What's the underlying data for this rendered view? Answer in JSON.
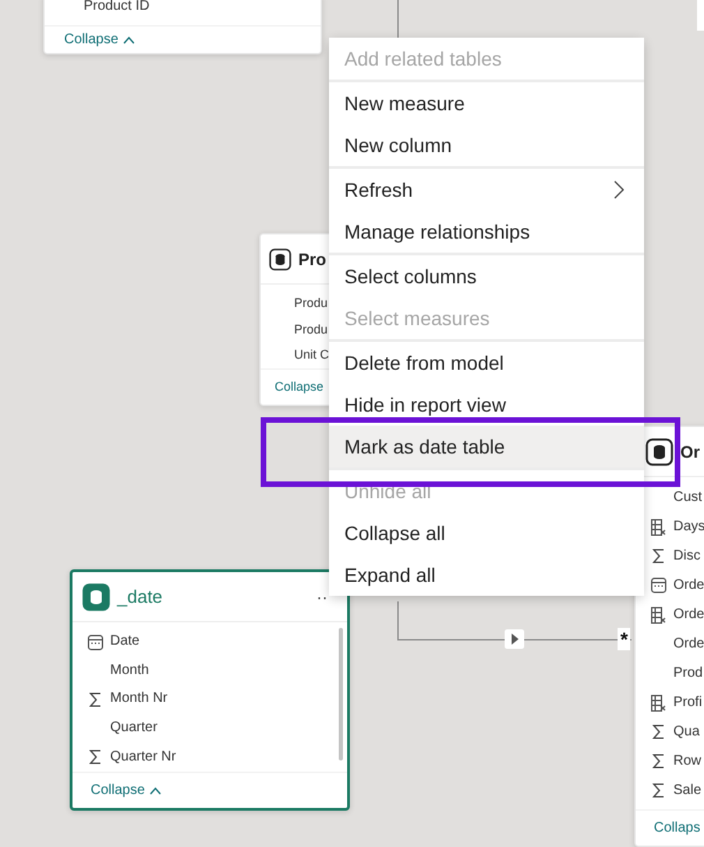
{
  "cards": [
    {
      "fields": [
        {
          "name": "Product ID",
          "kind": "plain"
        }
      ],
      "collapse": "Collapse",
      "selected": false
    },
    {
      "title": "Pro",
      "fields": [
        {
          "name": "Produ",
          "kind": "plain"
        },
        {
          "name": "Produ",
          "kind": "plain"
        },
        {
          "name": "Unit C",
          "kind": "plain"
        }
      ],
      "collapse": "Collapse",
      "selected": false
    },
    {
      "title": "Or",
      "fields": [
        {
          "name": "Cust",
          "kind": "plain"
        },
        {
          "name": "Days",
          "kind": "calculated"
        },
        {
          "name": "Disc",
          "kind": "sum"
        },
        {
          "name": "Orde",
          "kind": "date"
        },
        {
          "name": "Orde",
          "kind": "calculated"
        },
        {
          "name": "Orde",
          "kind": "plain"
        },
        {
          "name": "Prod",
          "kind": "plain"
        },
        {
          "name": "Profi",
          "kind": "calculated"
        },
        {
          "name": "Qua",
          "kind": "sum"
        },
        {
          "name": "Row",
          "kind": "sum"
        },
        {
          "name": "Sale",
          "kind": "sum"
        }
      ],
      "collapse": "Collaps",
      "selected": false
    },
    {
      "title": "_date",
      "fields": [
        {
          "name": "Date",
          "kind": "date"
        },
        {
          "name": "Month",
          "kind": "plain"
        },
        {
          "name": "Month Nr",
          "kind": "sum"
        },
        {
          "name": "Quarter",
          "kind": "plain"
        },
        {
          "name": "Quarter Nr",
          "kind": "sum"
        }
      ],
      "collapse": "Collapse",
      "selected": true,
      "more": "··"
    }
  ],
  "relationship": {
    "many_mark": "*"
  },
  "context_menu": {
    "items": [
      {
        "label": "Add related tables",
        "disabled": true,
        "submenu": false,
        "selected": false,
        "divider_after": true
      },
      {
        "label": "New measure",
        "disabled": false,
        "submenu": false,
        "selected": false,
        "divider_after": false
      },
      {
        "label": "New column",
        "disabled": false,
        "submenu": false,
        "selected": false,
        "divider_after": true
      },
      {
        "label": "Refresh",
        "disabled": false,
        "submenu": true,
        "selected": false,
        "divider_after": false
      },
      {
        "label": "Manage relationships",
        "disabled": false,
        "submenu": false,
        "selected": false,
        "divider_after": true
      },
      {
        "label": "Select columns",
        "disabled": false,
        "submenu": false,
        "selected": false,
        "divider_after": false
      },
      {
        "label": "Select measures",
        "disabled": true,
        "submenu": false,
        "selected": false,
        "divider_after": true
      },
      {
        "label": "Delete from model",
        "disabled": false,
        "submenu": false,
        "selected": false,
        "divider_after": false
      },
      {
        "label": "Hide in report view",
        "disabled": false,
        "submenu": false,
        "selected": false,
        "divider_after": false
      },
      {
        "label": "Mark as date table",
        "disabled": false,
        "submenu": false,
        "selected": true,
        "divider_after": true
      },
      {
        "label": "Unhide all",
        "disabled": true,
        "submenu": false,
        "selected": false,
        "divider_after": false
      },
      {
        "label": "Collapse all",
        "disabled": false,
        "submenu": false,
        "selected": false,
        "divider_after": false
      },
      {
        "label": "Expand all",
        "disabled": false,
        "submenu": false,
        "selected": false,
        "divider_after": false
      }
    ]
  },
  "highlight_frame": {
    "color": "#6b12d6"
  }
}
